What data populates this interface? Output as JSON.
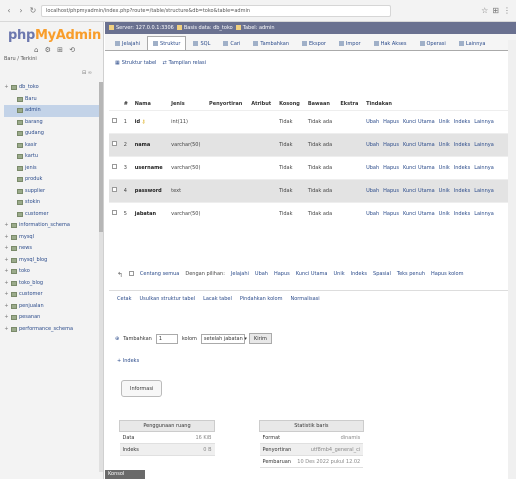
{
  "browser": {
    "url": "localhost/phpmyadmin/index.php?route=/table/structure&db=toko&table=admin",
    "back_icon": "arrow-left-icon",
    "forward_icon": "arrow-right-icon",
    "reload_icon": "reload-icon"
  },
  "sidebar": {
    "logo_a": "php",
    "logo_b": "MyAdmin",
    "logo_icons": "⌂ ⚙ ⊞ ⟲",
    "recent_label": "Baru / Terkini",
    "collapse_label": "⊟ ∞",
    "items": [
      {
        "label": "db_toko",
        "level": 0
      },
      {
        "label": "Baru",
        "level": 1
      },
      {
        "label": "admin",
        "level": 1,
        "active": true
      },
      {
        "label": "barang",
        "level": 1
      },
      {
        "label": "gudang",
        "level": 1
      },
      {
        "label": "kasir",
        "level": 1
      },
      {
        "label": "kartu",
        "level": 1
      },
      {
        "label": "jenis",
        "level": 1
      },
      {
        "label": "produk",
        "level": 1
      },
      {
        "label": "supplier",
        "level": 1
      },
      {
        "label": "stokin",
        "level": 1
      },
      {
        "label": "customer",
        "level": 1
      },
      {
        "label": "information_schema",
        "level": 0
      },
      {
        "label": "mysql",
        "level": 0
      },
      {
        "label": "news",
        "level": 0
      },
      {
        "label": "mysql_blog",
        "level": 0
      },
      {
        "label": "toko",
        "level": 0
      },
      {
        "label": "toko_blog",
        "level": 0
      },
      {
        "label": "customer",
        "level": 0
      },
      {
        "label": "penjualan",
        "level": 0
      },
      {
        "label": "pesanan",
        "level": 0
      },
      {
        "label": "performance_schema",
        "level": 0
      }
    ]
  },
  "main": {
    "breadcrumb": [
      "Server: 127.0.0.1:3306",
      "Basis data: db_toko",
      "Tabel: admin"
    ],
    "tabs": [
      {
        "label": "Jelajahi",
        "active": false
      },
      {
        "label": "Struktur",
        "active": true
      },
      {
        "label": "SQL",
        "active": false
      },
      {
        "label": "Cari",
        "active": false
      },
      {
        "label": "Tambahkan",
        "active": false
      },
      {
        "label": "Ekspor",
        "active": false
      },
      {
        "label": "Impor",
        "active": false
      },
      {
        "label": "Hak Akses",
        "active": false
      },
      {
        "label": "Operasi",
        "active": false
      },
      {
        "label": "Lainnya",
        "active": false
      }
    ],
    "subtoolbar": {
      "structure": "Struktur tabel",
      "relation": "Tampilan relasi"
    },
    "structure_table": {
      "headers": [
        "#",
        "Nama",
        "Jenis",
        "Penyortiran",
        "Atribut",
        "Kosong",
        "Bawaan",
        "Ekstra",
        "Tindakan"
      ],
      "rows": [
        {
          "num": "1",
          "name": "id",
          "key": true,
          "type": "int(11)",
          "collation": "",
          "attributes": "",
          "null": "Tidak",
          "default": "Tidak ada",
          "extra": ""
        },
        {
          "num": "2",
          "name": "nama",
          "key": false,
          "type": "varchar(50)",
          "collation": "",
          "attributes": "",
          "null": "Tidak",
          "default": "Tidak ada",
          "extra": ""
        },
        {
          "num": "3",
          "name": "username",
          "key": false,
          "type": "varchar(50)",
          "collation": "",
          "attributes": "",
          "null": "Tidak",
          "default": "Tidak ada",
          "extra": ""
        },
        {
          "num": "4",
          "name": "password",
          "key": false,
          "type": "text",
          "collation": "",
          "attributes": "",
          "null": "Tidak",
          "default": "Tidak ada",
          "extra": ""
        },
        {
          "num": "5",
          "name": "jabatan",
          "key": false,
          "type": "varchar(50)",
          "collation": "",
          "attributes": "",
          "null": "Tidak",
          "default": "Tidak ada",
          "extra": ""
        }
      ],
      "actions": [
        "Ubah",
        "Hapus",
        "Kunci Utama",
        "Unik",
        "Indeks",
        "Lainnya"
      ]
    },
    "checkall": {
      "check_all": "Centang semua",
      "with_selected": "Dengan pilihan:",
      "actions": [
        "Jelajahi",
        "Ubah",
        "Hapus",
        "Kunci Utama",
        "Unik",
        "Indeks",
        "Spasial",
        "Teks penuh",
        "Hapus kolom"
      ]
    },
    "print_links": [
      "Cetak",
      "Usulkan struktur tabel",
      "Lacak tabel",
      "Pindahkan kolom",
      "Normalisasi"
    ],
    "add_row": {
      "label": "Tambahkan",
      "count": "1",
      "unit": "kolom",
      "position": "setelah jabatan",
      "go": "Kirim"
    },
    "indexes_link": "+ Indeks",
    "indexes_button": "Informasi",
    "usage": {
      "header": "Penggunaan ruang",
      "rows": [
        {
          "k": "Data",
          "v": "16 KiB"
        },
        {
          "k": "Indeks",
          "v": "0 B"
        }
      ]
    },
    "row_stats": {
      "header": "Statistik baris",
      "rows": [
        {
          "k": "Format",
          "v": "dinamis"
        },
        {
          "k": "Penyortiran",
          "v": "utf8mb4_general_ci"
        },
        {
          "k": "Pembaruan",
          "v": "10 Des 2022 pukul 12.02"
        }
      ]
    },
    "console": "Konsol"
  },
  "colors": {
    "accent": "#6c78af",
    "logo_orange": "#f89d2b",
    "breadcrumb_bg": "#6a7190"
  }
}
